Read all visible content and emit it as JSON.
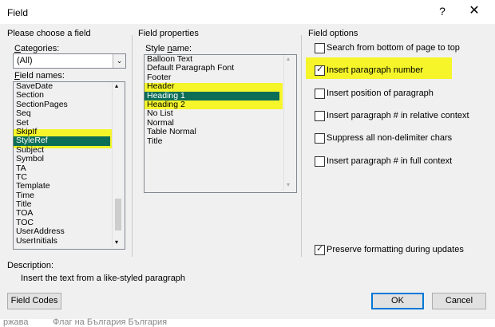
{
  "window": {
    "title": "Field",
    "help_glyph": "?",
    "close_glyph": "✕"
  },
  "left": {
    "section_title": "Please choose a field",
    "categories_label": "Categories:",
    "categories_value": "(All)",
    "field_names_label": "Field names:",
    "field_names": [
      "SaveDate",
      "Section",
      "SectionPages",
      "Seq",
      "Set",
      "SkipIf",
      "StyleRef",
      "Subject",
      "Symbol",
      "TA",
      "TC",
      "Template",
      "Time",
      "Title",
      "TOA",
      "TOC",
      "UserAddress",
      "UserInitials"
    ],
    "selected": "StyleRef"
  },
  "middle": {
    "section_title": "Field properties",
    "style_name_label": "Style name:",
    "styles": [
      "Balloon Text",
      "Default Paragraph Font",
      "Footer",
      "Header",
      "Heading 1",
      "Heading 2",
      "No List",
      "Normal",
      "Table Normal",
      "Title"
    ],
    "selected": "Heading 1"
  },
  "right": {
    "section_title": "Field options",
    "options": [
      {
        "label": "Search from bottom of page to top",
        "checked": false
      },
      {
        "label": "Insert paragraph number",
        "checked": true
      },
      {
        "label": "Insert position of paragraph",
        "checked": false
      },
      {
        "label": "Insert paragraph # in relative context",
        "checked": false
      },
      {
        "label": "Suppress all non-delimiter chars",
        "checked": false
      },
      {
        "label": "Insert paragraph # in full context",
        "checked": false
      }
    ],
    "preserve_label": "Preserve formatting during updates",
    "preserve_checked": true
  },
  "description": {
    "label": "Description:",
    "text": "Insert the text from a like-styled paragraph"
  },
  "buttons": {
    "field_codes": "Field Codes",
    "ok": "OK",
    "cancel": "Cancel"
  },
  "background_text": "ржава          Флаг на България България",
  "colors": {
    "selection": "#0d6e58",
    "highlight": "#f5f52a",
    "accent": "#0078d7"
  }
}
